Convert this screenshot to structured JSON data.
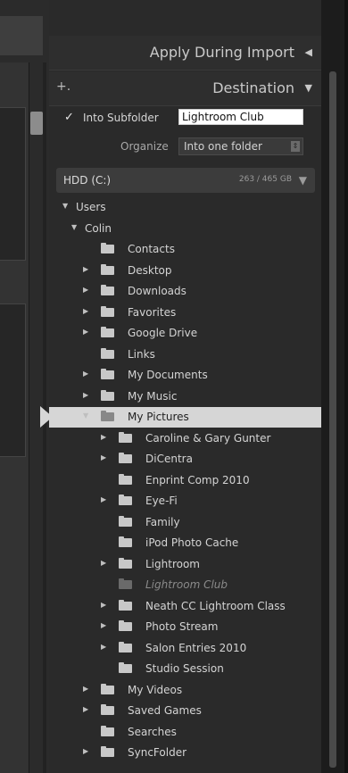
{
  "header_apply": {
    "title": "Apply During Import"
  },
  "header_dest": {
    "title": "Destination",
    "plus": "+."
  },
  "subfolder": {
    "label": "Into Subfolder",
    "value": "Lightroom Club",
    "checked": true
  },
  "organize": {
    "label": "Organize",
    "value": "Into one folder"
  },
  "drive": {
    "name": "HDD (C:)",
    "capacity": "263 / 465 GB"
  },
  "tree": [
    {
      "label": "Users",
      "level": 0
    },
    {
      "label": "Colin",
      "level": 1
    },
    {
      "label": "Contacts",
      "level": 2
    },
    {
      "label": "Desktop",
      "level": 2
    },
    {
      "label": "Downloads",
      "level": 2
    },
    {
      "label": "Favorites",
      "level": 2
    },
    {
      "label": "Google Drive",
      "level": 2
    },
    {
      "label": "Links",
      "level": 2
    },
    {
      "label": "My Documents",
      "level": 2
    },
    {
      "label": "My Music",
      "level": 2
    },
    {
      "label": "My Pictures",
      "level": 2,
      "selected": true
    },
    {
      "label": "Caroline & Gary Gunter",
      "level": 3
    },
    {
      "label": "DiCentra",
      "level": 3
    },
    {
      "label": "Enprint Comp 2010",
      "level": 3
    },
    {
      "label": "Eye-Fi",
      "level": 3
    },
    {
      "label": "Family",
      "level": 3
    },
    {
      "label": "iPod Photo Cache",
      "level": 3
    },
    {
      "label": "Lightroom",
      "level": 3
    },
    {
      "label": "Lightroom Club",
      "level": 3,
      "ghost": true
    },
    {
      "label": "Neath CC Lightroom Class",
      "level": 3
    },
    {
      "label": "Photo Stream",
      "level": 3
    },
    {
      "label": "Salon Entries 2010",
      "level": 3
    },
    {
      "label": "Studio Session",
      "level": 3
    },
    {
      "label": "My Videos",
      "level": 2
    },
    {
      "label": "Saved Games",
      "level": 2
    },
    {
      "label": "Searches",
      "level": 2
    },
    {
      "label": "SyncFolder",
      "level": 2
    }
  ]
}
